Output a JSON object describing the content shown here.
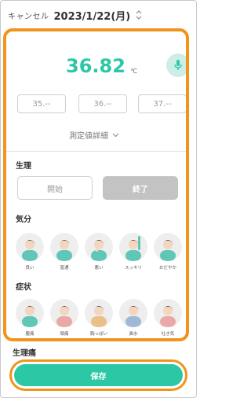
{
  "header": {
    "cancel_label": "キャンセル",
    "date": "2023/1/22(月)"
  },
  "temperature": {
    "value": "36.82",
    "unit": "℃",
    "whole_placeholder": "35.--",
    "mid_placeholder": "36.--",
    "high_placeholder": "37.--",
    "detail_label": "測定値詳細"
  },
  "period": {
    "title": "生理",
    "start_label": "開始",
    "end_label": "終了"
  },
  "mood": {
    "title": "気分",
    "items": [
      {
        "label": "良い"
      },
      {
        "label": "普通"
      },
      {
        "label": "悪い"
      },
      {
        "label": "スッキリ"
      },
      {
        "label": "おだやか"
      }
    ]
  },
  "symptoms": {
    "title": "症状",
    "items": [
      {
        "label": "腹痛"
      },
      {
        "label": "頭痛"
      },
      {
        "label": "胸っぽい"
      },
      {
        "label": "鼻水"
      },
      {
        "label": "吐き気"
      }
    ]
  },
  "period_flow": {
    "title": "生理痛"
  },
  "save": {
    "label": "保存"
  },
  "colors": {
    "accent": "#2cc8a6",
    "highlight": "#f0941c",
    "disabled": "#c3c3c3"
  }
}
